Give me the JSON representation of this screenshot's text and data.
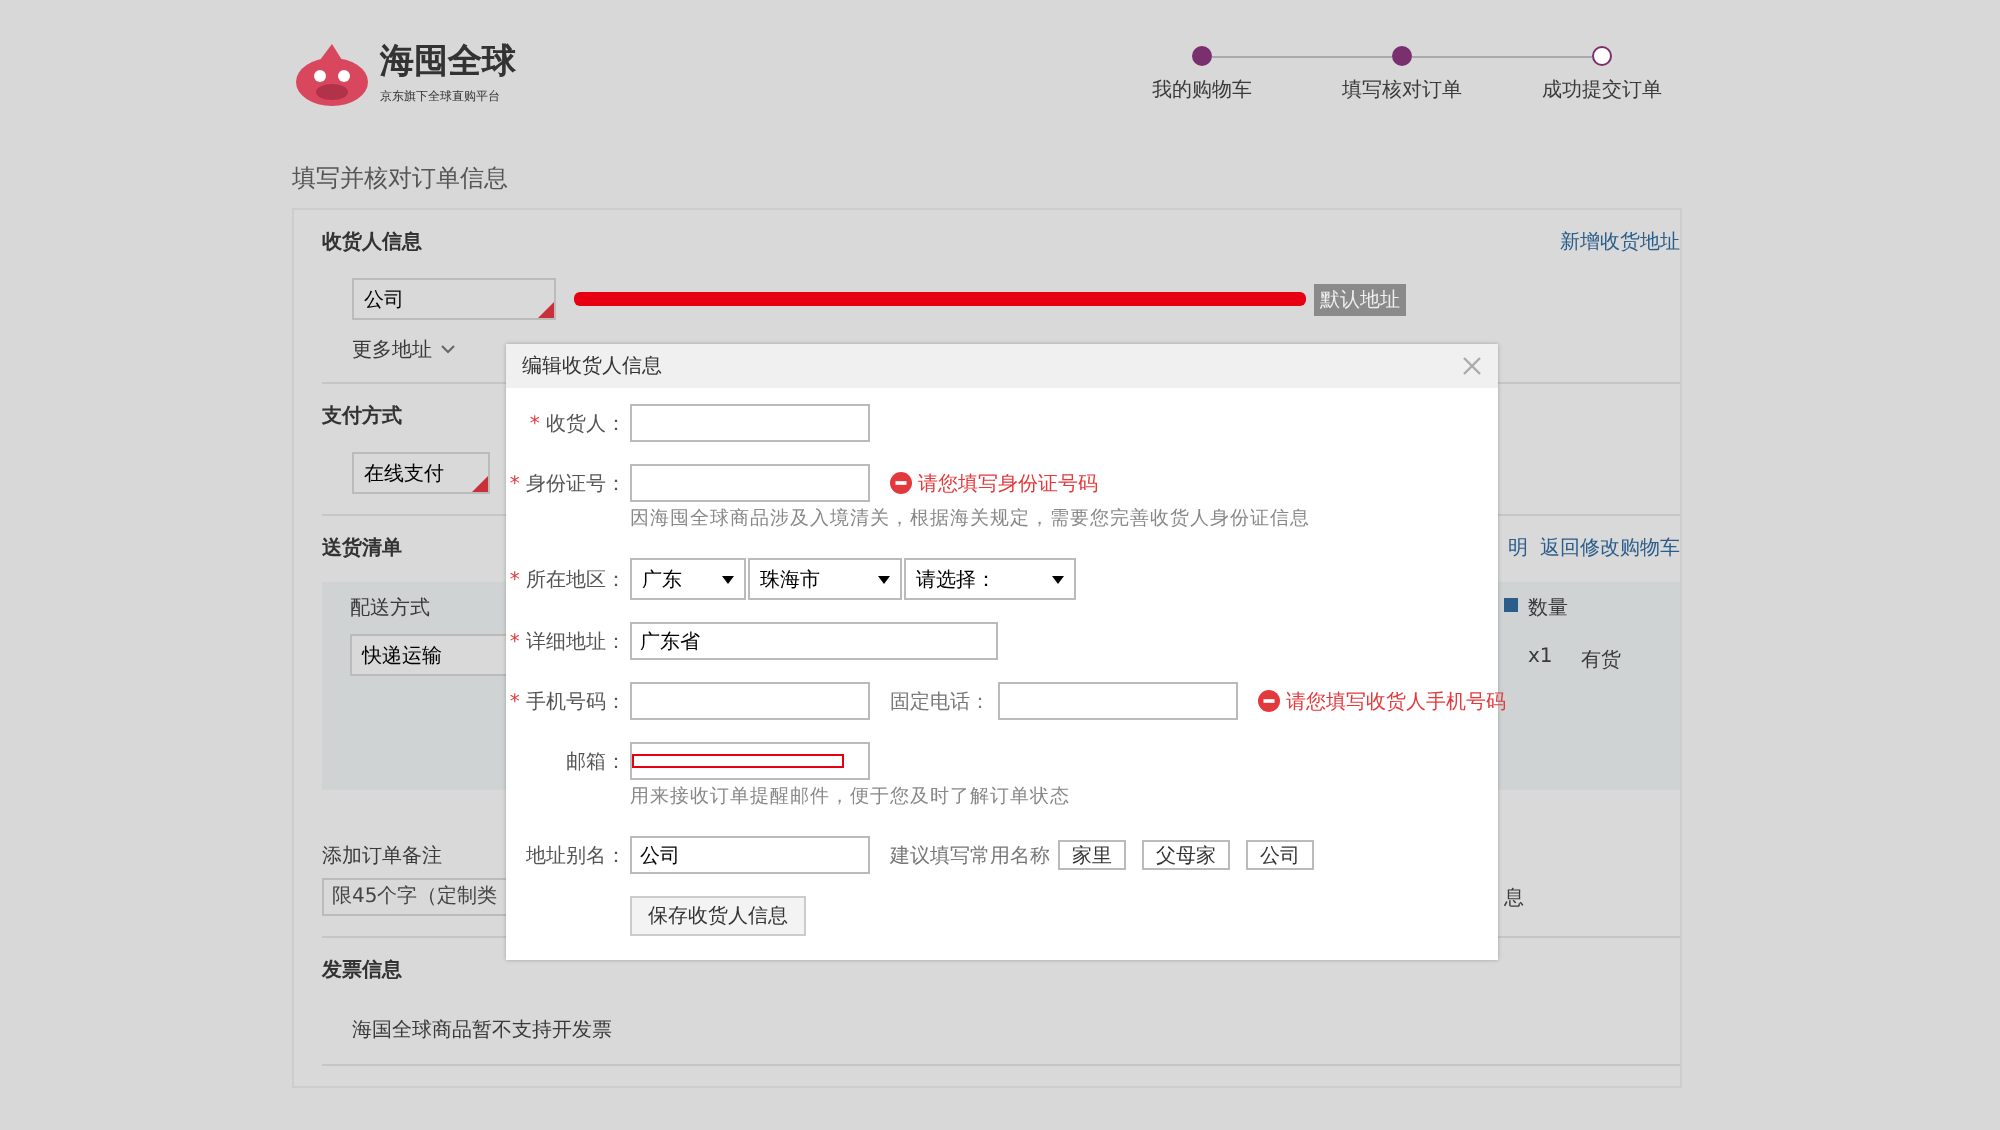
{
  "header": {
    "logo_name": "海囤全球",
    "logo_tagline": "京东旗下全球直购平台",
    "steps": [
      {
        "label": "我的购物车",
        "done": true
      },
      {
        "label": "填写核对订单",
        "done": true
      },
      {
        "label": "成功提交订单",
        "done": false
      }
    ]
  },
  "heading": "填写并核对订单信息",
  "consignee": {
    "title": "收货人信息",
    "add_link": "新增收货地址",
    "address_button": {
      "label": "公司",
      "selected": true
    },
    "default_tag": "默认地址",
    "more": "更多地址"
  },
  "payment": {
    "title": "支付方式",
    "option": {
      "label": "在线支付",
      "selected": true
    }
  },
  "shipping": {
    "title": "送货清单",
    "partial_link": "明",
    "return_link": "返回修改购物车",
    "method_label": "配送方式",
    "method": {
      "label": "快递运输",
      "selected": true
    },
    "qty_header": "数量",
    "qty": "x1",
    "stock": "有货"
  },
  "note": {
    "label": "添加订单备注",
    "placeholder": "限45个字（定制类",
    "partial_text": "息"
  },
  "invoice": {
    "title": "发票信息",
    "text": "海国全球商品暂不支持开发票"
  },
  "dialog": {
    "title": "编辑收货人信息",
    "fields": [
      {
        "kind": "input",
        "mark": "*",
        "label": "收货人："
      },
      {
        "kind": "input",
        "mark": "*",
        "label": "身份证号：",
        "error": "请您填写身份证号码",
        "hint": "因海囤全球商品涉及入境清关，根据海关规定，需要您完善收货人身份证信息"
      },
      {
        "kind": "selects",
        "mark": "*",
        "label": "所在地区：",
        "options": [
          "广东",
          "珠海市",
          "请选择："
        ]
      },
      {
        "kind": "wide",
        "mark": "*",
        "label": "详细地址：",
        "value": "广东省"
      },
      {
        "kind": "phone",
        "mark": "*",
        "label": "手机号码：",
        "second_label": "固定电话：",
        "error": "请您填写收货人手机号码"
      },
      {
        "kind": "redacted",
        "label": "邮箱：",
        "hint": "用来接收订单提醒邮件，便于您及时了解订单状态"
      },
      {
        "kind": "alias",
        "label": "地址别名：",
        "value": "公司",
        "suggestion_label": "建议填写常用名称",
        "suggestions": [
          "家里",
          "父母家",
          "公司"
        ]
      }
    ],
    "save_button": "保存收货人信息"
  }
}
